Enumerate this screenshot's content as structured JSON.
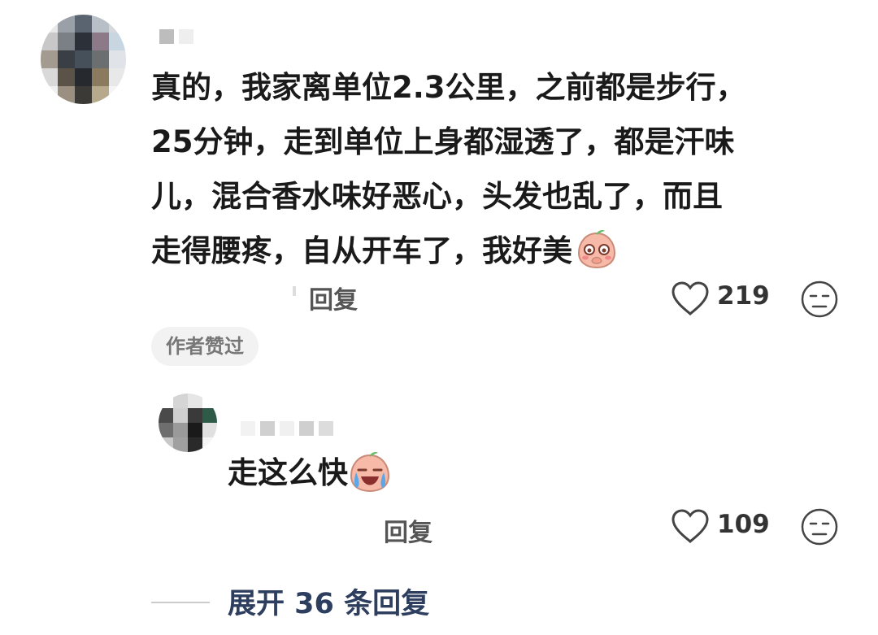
{
  "comment": {
    "lines": [
      "真的，我家离单位2.3公里，之前都是步行，",
      "25分钟，走到单位上身都湿透了，都是汗味",
      "儿，混合香水味好恶心，头发也乱了，而且",
      "走得腰疼，自从开车了，我好美"
    ],
    "emoji_icon": "shy-peach-emoji",
    "reply_label": "回复",
    "like_count": "219",
    "author_badge": "作者赞过"
  },
  "reply": {
    "text": "走这么快",
    "emoji_icon": "crying-laugh-peach-emoji",
    "reply_label": "回复",
    "like_count": "109"
  },
  "expand": {
    "label": "展开 36 条回复"
  },
  "colors": {
    "text": "#1a1a1a",
    "muted": "#555555",
    "badge_bg": "#f2f2f2",
    "expand_link": "#2d3e5e",
    "emoji_peach": "#f7b9a8"
  }
}
